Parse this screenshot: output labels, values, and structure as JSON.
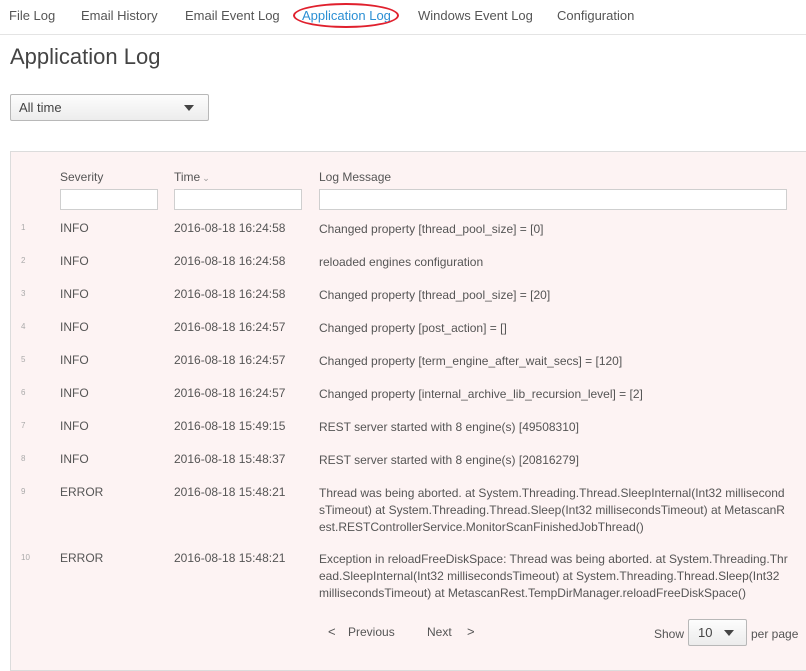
{
  "tabs": [
    {
      "label": "File Log"
    },
    {
      "label": "Email History"
    },
    {
      "label": "Email Event Log"
    },
    {
      "label": "Application Log",
      "active": true
    },
    {
      "label": "Windows Event Log"
    },
    {
      "label": "Configuration"
    }
  ],
  "page": {
    "title": "Application Log"
  },
  "filter": {
    "time_range": "All time"
  },
  "table": {
    "columns": [
      "Severity",
      "Time",
      "Log Message"
    ],
    "sort_indicator": "⌄",
    "rows": [
      {
        "num": "1",
        "severity": "INFO",
        "time": "2016-08-18 16:24:58",
        "message": "Changed property [thread_pool_size] = [0]"
      },
      {
        "num": "2",
        "severity": "INFO",
        "time": "2016-08-18 16:24:58",
        "message": "reloaded engines configuration"
      },
      {
        "num": "3",
        "severity": "INFO",
        "time": "2016-08-18 16:24:58",
        "message": "Changed property [thread_pool_size] = [20]"
      },
      {
        "num": "4",
        "severity": "INFO",
        "time": "2016-08-18 16:24:57",
        "message": "Changed property [post_action] = []"
      },
      {
        "num": "5",
        "severity": "INFO",
        "time": "2016-08-18 16:24:57",
        "message": "Changed property [term_engine_after_wait_secs] = [120]"
      },
      {
        "num": "6",
        "severity": "INFO",
        "time": "2016-08-18 16:24:57",
        "message": "Changed property [internal_archive_lib_recursion_level] = [2]"
      },
      {
        "num": "7",
        "severity": "INFO",
        "time": "2016-08-18 15:49:15",
        "message": "REST server started with 8 engine(s) [49508310]"
      },
      {
        "num": "8",
        "severity": "INFO",
        "time": "2016-08-18 15:48:37",
        "message": "REST server started with 8 engine(s) [20816279]"
      },
      {
        "num": "9",
        "severity": "ERROR",
        "time": "2016-08-18 15:48:21",
        "message": "Thread was being aborted. at System.Threading.Thread.SleepInternal(Int32 millisecondsTimeout) at System.Threading.Thread.Sleep(Int32 millisecondsTimeout) at MetascanRest.RESTControllerService.MonitorScanFinishedJobThread()"
      },
      {
        "num": "10",
        "severity": "ERROR",
        "time": "2016-08-18 15:48:21",
        "message": "Exception in reloadFreeDiskSpace: Thread was being aborted. at System.Threading.Thread.SleepInternal(Int32 millisecondsTimeout) at System.Threading.Thread.Sleep(Int32 millisecondsTimeout) at MetascanRest.TempDirManager.reloadFreeDiskSpace()"
      }
    ]
  },
  "pager": {
    "prev_arrow": "<",
    "previous": "Previous",
    "next": "Next",
    "next_arrow": ">",
    "show_label": "Show",
    "page_size": "10",
    "per_page_label": "per page"
  }
}
